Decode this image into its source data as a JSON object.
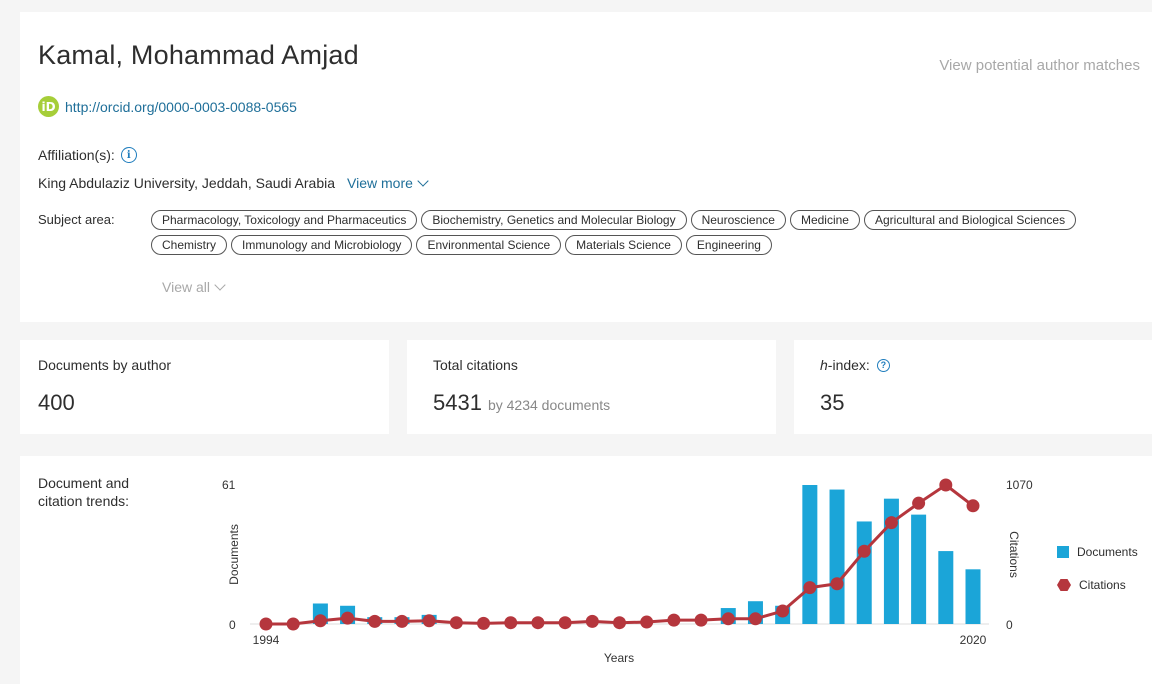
{
  "author": {
    "name": "Kamal, Mohammad Amjad",
    "view_matches": "View potential author matches",
    "orcid_icon": "iD",
    "orcid_url": "http://orcid.org/0000-0003-0088-0565",
    "affiliation_label": "Affiliation(s):",
    "info_icon": "i",
    "affiliation": "King Abdulaziz University, Jeddah, Saudi Arabia",
    "view_more": "View more",
    "subject_label": "Subject area:",
    "subjects": [
      "Pharmacology, Toxicology and Pharmaceutics",
      "Biochemistry, Genetics and Molecular Biology",
      "Neuroscience",
      "Medicine",
      "Agricultural and Biological Sciences",
      "Chemistry",
      "Immunology and Microbiology",
      "Environmental Science",
      "Materials Science",
      "Engineering"
    ],
    "view_all": "View all"
  },
  "metrics": {
    "documents_label": "Documents by author",
    "documents_value": "400",
    "citations_label": "Total citations",
    "citations_value": "5431",
    "citations_sub": "by 4234 documents",
    "hindex_label_italic": "h",
    "hindex_label_rest": "-index:",
    "hindex_help_icon": "?",
    "hindex_value": "35"
  },
  "colors": {
    "documents_bar": "#1ba5d8",
    "citations_line": "#b5363d",
    "link": "#1f6f99",
    "orcid": "#a6ce39"
  },
  "chart_label": "Document and citation trends:",
  "chart_data": {
    "type": "bar",
    "x": [
      1994,
      1995,
      1996,
      1997,
      1998,
      1999,
      2000,
      2001,
      2002,
      2003,
      2004,
      2005,
      2006,
      2007,
      2008,
      2009,
      2010,
      2011,
      2012,
      2013,
      2014,
      2015,
      2016,
      2017,
      2018,
      2019,
      2020
    ],
    "series": [
      {
        "name": "Documents",
        "type": "bar",
        "axis": "left",
        "values": [
          0,
          0,
          9,
          8,
          3,
          3,
          4,
          0,
          0,
          0,
          0,
          0,
          0,
          0,
          0,
          0,
          0,
          7,
          10,
          8,
          61,
          59,
          45,
          55,
          48,
          32,
          24
        ]
      },
      {
        "name": "Citations",
        "type": "line",
        "axis": "right",
        "values": [
          0,
          0,
          25,
          45,
          20,
          20,
          25,
          10,
          5,
          10,
          10,
          10,
          20,
          10,
          15,
          30,
          30,
          40,
          40,
          100,
          280,
          310,
          560,
          780,
          930,
          1070,
          910
        ]
      }
    ],
    "ylabel_left": "Documents",
    "ylabel_right": "Citations",
    "xlabel": "Years",
    "ylim_left": [
      0,
      61
    ],
    "ylim_right": [
      0,
      1070
    ],
    "left_ticks": [
      "61",
      "0"
    ],
    "right_ticks": [
      "1070",
      "0"
    ],
    "x_tick_labels": [
      "1994",
      "2020"
    ],
    "legend_position": "right"
  }
}
